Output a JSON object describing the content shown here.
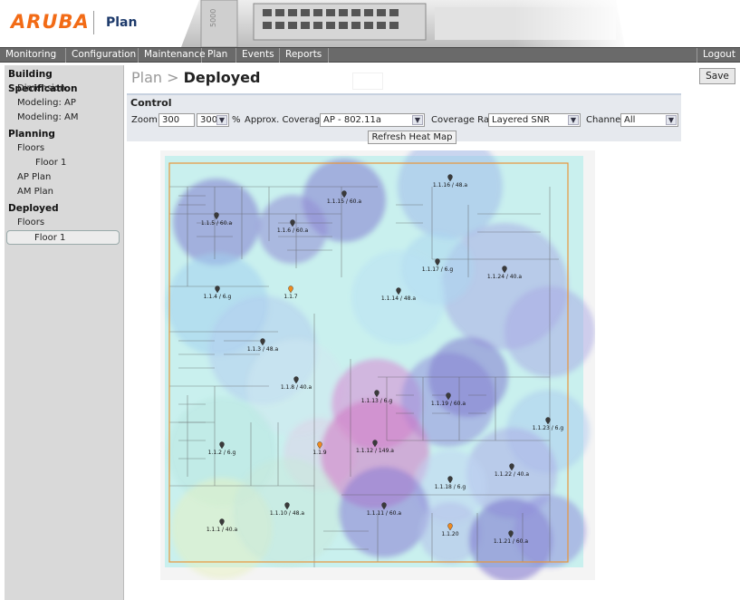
{
  "header": {
    "logo_text": "ARUBA",
    "app_title": "Plan",
    "hw_model": "5000"
  },
  "nav": {
    "items": [
      "Monitoring",
      "Configuration",
      "Maintenance",
      "Plan",
      "Events",
      "Reports"
    ],
    "logout": "Logout"
  },
  "sidebar": {
    "building_spec": "Building Specification",
    "dimension": "Dimension",
    "modeling_ap": "Modeling: AP",
    "modeling_am": "Modeling: AM",
    "planning": "Planning",
    "planning_floors": "Floors",
    "planning_floor1": "Floor 1",
    "ap_plan": "AP Plan",
    "am_plan": "AM Plan",
    "deployed": "Deployed",
    "deployed_floors": "Floors",
    "deployed_floor1": "Floor 1"
  },
  "page": {
    "breadcrumb_parent": "Plan",
    "breadcrumb_sep": ">",
    "breadcrumb_current": "Deployed",
    "save_label": "Save"
  },
  "control": {
    "heading": "Control",
    "zoom_label": "Zoom",
    "zoom_value": "300",
    "zoom_select": "300",
    "percent": "%",
    "coverage_label": "Approx. Coverage",
    "coverage_value": "AP - 802.11a",
    "rate_label": "Coverage Rate",
    "rate_value": "Layered SNR",
    "channel_label": "Channel",
    "channel_value": "All",
    "refresh_label": "Refresh Heat Map"
  },
  "access_points": [
    {
      "label": "1.1.5 / 60.a"
    },
    {
      "label": "1.1.15 / 60.a"
    },
    {
      "label": "1.1.16 / 48.a"
    },
    {
      "label": "1.1.6 / 60.a"
    },
    {
      "label": "1.1.17 / 6.g"
    },
    {
      "label": "1.1.24 / 40.a"
    },
    {
      "label": "1.1.4 / 6.g"
    },
    {
      "label": "1.1.7"
    },
    {
      "label": "1.1.14 / 48.a"
    },
    {
      "label": "1.1.3 / 48.a"
    },
    {
      "label": "1.1.8 / 40.a"
    },
    {
      "label": "1.1.13 / 6.g"
    },
    {
      "label": "1.1.19 / 60.a"
    },
    {
      "label": "1.1.23 / 6.g"
    },
    {
      "label": "1.1.2 / 6.g"
    },
    {
      "label": "1.1.9"
    },
    {
      "label": "1.1.12 / 149.a"
    },
    {
      "label": "1.1.22 / 40.a"
    },
    {
      "label": "1.1.18 / 6.g"
    },
    {
      "label": "1.1.1 / 40.a"
    },
    {
      "label": "1.1.10 / 48.a"
    },
    {
      "label": "1.1.11 / 60.a"
    },
    {
      "label": "1.1.20"
    },
    {
      "label": "1.1.21 / 60.a"
    }
  ]
}
